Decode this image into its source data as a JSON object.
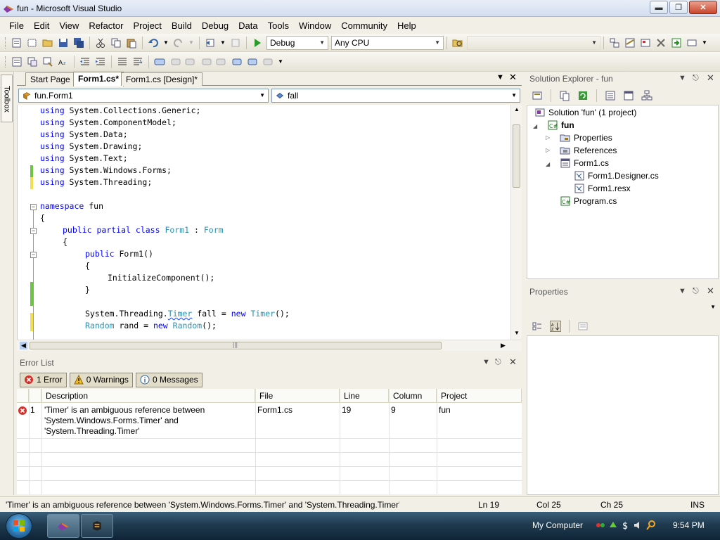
{
  "window": {
    "title": "fun - Microsoft Visual Studio"
  },
  "menu": [
    "File",
    "Edit",
    "View",
    "Refactor",
    "Project",
    "Build",
    "Debug",
    "Data",
    "Tools",
    "Window",
    "Community",
    "Help"
  ],
  "toolbar": {
    "config": "Debug",
    "platform": "Any CPU",
    "find": ""
  },
  "toolbox": {
    "label": "Toolbox"
  },
  "tabs": [
    {
      "label": "Start Page",
      "active": false
    },
    {
      "label": "Form1.cs*",
      "active": true
    },
    {
      "label": "Form1.cs [Design]*",
      "active": false
    }
  ],
  "editor": {
    "type_combo": "fun.Form1",
    "member_combo": "fall",
    "lines": [
      {
        "indent": 0,
        "parts": [
          {
            "t": "using",
            "c": "kw"
          },
          {
            "t": " System.Collections.Generic;",
            "c": ""
          }
        ]
      },
      {
        "indent": 0,
        "parts": [
          {
            "t": "using",
            "c": "kw"
          },
          {
            "t": " System.ComponentModel;",
            "c": ""
          }
        ]
      },
      {
        "indent": 0,
        "parts": [
          {
            "t": "using",
            "c": "kw"
          },
          {
            "t": " System.Data;",
            "c": ""
          }
        ]
      },
      {
        "indent": 0,
        "parts": [
          {
            "t": "using",
            "c": "kw"
          },
          {
            "t": " System.Drawing;",
            "c": ""
          }
        ]
      },
      {
        "indent": 0,
        "parts": [
          {
            "t": "using",
            "c": "kw"
          },
          {
            "t": " System.Text;",
            "c": ""
          }
        ]
      },
      {
        "indent": 0,
        "parts": [
          {
            "t": "using",
            "c": "kw"
          },
          {
            "t": " System.Windows.Forms;",
            "c": ""
          }
        ]
      },
      {
        "indent": 0,
        "parts": [
          {
            "t": "using",
            "c": "kw"
          },
          {
            "t": " System.Threading;",
            "c": ""
          }
        ]
      },
      {
        "indent": 0,
        "parts": []
      },
      {
        "indent": 0,
        "parts": [
          {
            "t": "namespace",
            "c": "kw"
          },
          {
            "t": " fun",
            "c": ""
          }
        ]
      },
      {
        "indent": 0,
        "parts": [
          {
            "t": "{",
            "c": ""
          }
        ]
      },
      {
        "indent": 4,
        "parts": [
          {
            "t": "public",
            "c": "kw"
          },
          {
            "t": " ",
            "c": ""
          },
          {
            "t": "partial",
            "c": "kw"
          },
          {
            "t": " ",
            "c": ""
          },
          {
            "t": "class",
            "c": "kw"
          },
          {
            "t": " ",
            "c": ""
          },
          {
            "t": "Form1",
            "c": "ty"
          },
          {
            "t": " : ",
            "c": ""
          },
          {
            "t": "Form",
            "c": "ty"
          }
        ]
      },
      {
        "indent": 4,
        "parts": [
          {
            "t": "{",
            "c": ""
          }
        ]
      },
      {
        "indent": 8,
        "parts": [
          {
            "t": "public",
            "c": "kw"
          },
          {
            "t": " Form1()",
            "c": ""
          }
        ]
      },
      {
        "indent": 8,
        "parts": [
          {
            "t": "{",
            "c": ""
          }
        ]
      },
      {
        "indent": 12,
        "parts": [
          {
            "t": "InitializeComponent();",
            "c": ""
          }
        ]
      },
      {
        "indent": 8,
        "parts": [
          {
            "t": "}",
            "c": ""
          }
        ]
      },
      {
        "indent": 0,
        "parts": []
      },
      {
        "indent": 8,
        "parts": [
          {
            "t": "System.Threading",
            "c": ""
          },
          {
            "t": ".",
            "c": ""
          },
          {
            "t": "Timer",
            "c": "squig"
          },
          {
            "t": " fall = ",
            "c": ""
          },
          {
            "t": "new",
            "c": "kw"
          },
          {
            "t": " ",
            "c": ""
          },
          {
            "t": "Timer",
            "c": "ty"
          },
          {
            "t": "();",
            "c": ""
          }
        ]
      },
      {
        "indent": 8,
        "parts": [
          {
            "t": "Random",
            "c": "ty"
          },
          {
            "t": " rand = ",
            "c": ""
          },
          {
            "t": "new",
            "c": "kw"
          },
          {
            "t": " ",
            "c": ""
          },
          {
            "t": "Random",
            "c": "ty"
          },
          {
            "t": "();",
            "c": ""
          }
        ]
      }
    ]
  },
  "error_list": {
    "title": "Error List",
    "buttons": {
      "errors": "1 Error",
      "warnings": "0 Warnings",
      "messages": "0 Messages"
    },
    "columns": [
      "",
      "Description",
      "File",
      "Line",
      "Column",
      "Project"
    ],
    "rows": [
      {
        "num": "1",
        "description": [
          "'Timer' is an ambiguous reference between",
          "'System.Windows.Forms.Timer' and",
          "'System.Threading.Timer'"
        ],
        "file": "Form1.cs",
        "line": "19",
        "column": "9",
        "project": "fun"
      }
    ]
  },
  "solution_explorer": {
    "title": "Solution Explorer - fun",
    "items": [
      {
        "label": "Solution 'fun' (1 project)",
        "icon": "solution-icon",
        "level": 0
      },
      {
        "label": "fun",
        "icon": "csharp-project-icon",
        "level": 1,
        "bold": true
      },
      {
        "label": "Properties",
        "icon": "properties-folder-icon",
        "level": 2
      },
      {
        "label": "References",
        "icon": "references-folder-icon",
        "level": 2
      },
      {
        "label": "Form1.cs",
        "icon": "form-icon",
        "level": 2
      },
      {
        "label": "Form1.Designer.cs",
        "icon": "cs-file-icon",
        "level": 3
      },
      {
        "label": "Form1.resx",
        "icon": "resx-file-icon",
        "level": 3
      },
      {
        "label": "Program.cs",
        "icon": "cs-file-icon",
        "level": 2
      }
    ]
  },
  "properties": {
    "title": "Properties"
  },
  "status": {
    "message": "'Timer' is an ambiguous reference between 'System.Windows.Forms.Timer' and 'System.Threading.Timer'",
    "line": "Ln 19",
    "col": "Col 25",
    "ch": "Ch 25",
    "mode": "INS"
  },
  "taskbar": {
    "tray_label": "My Computer",
    "time": "9:54 PM"
  }
}
